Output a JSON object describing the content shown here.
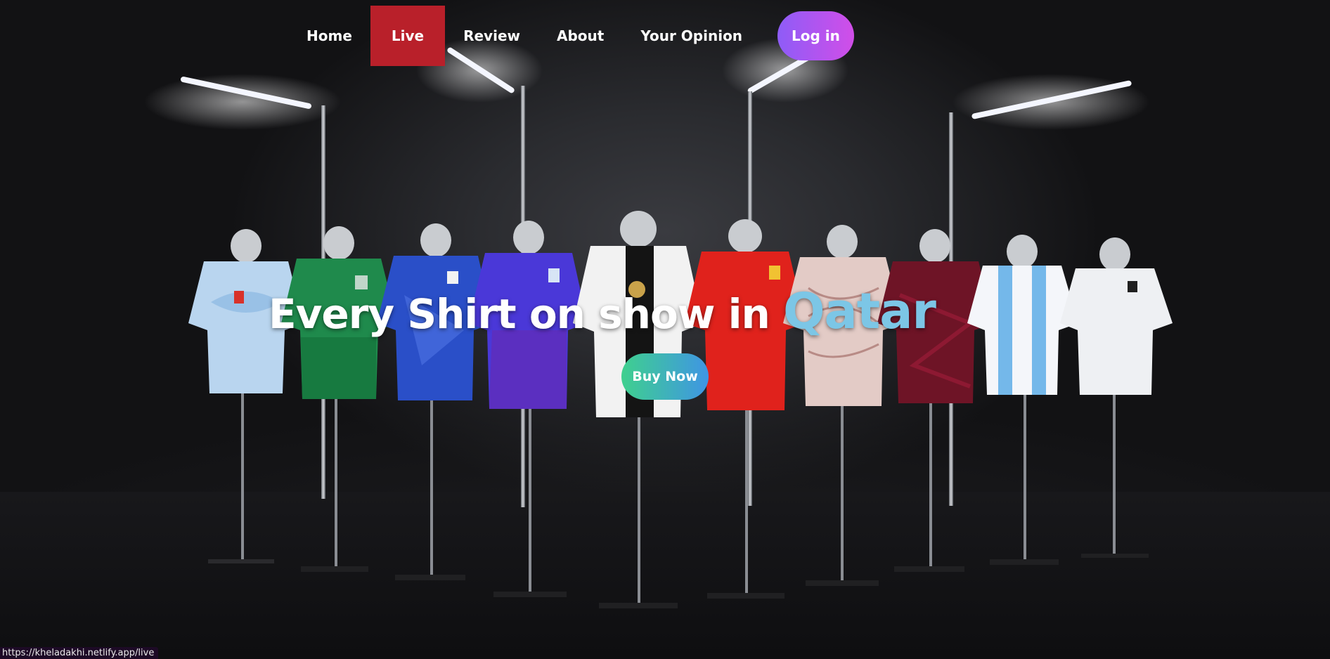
{
  "nav": {
    "items": [
      {
        "label": "Home",
        "active": false
      },
      {
        "label": "Live",
        "active": true
      },
      {
        "label": "Review",
        "active": false
      },
      {
        "label": "About",
        "active": false
      },
      {
        "label": "Your Opinion",
        "active": false
      }
    ],
    "login_label": "Log in"
  },
  "hero": {
    "title": "Every Shirt on show in",
    "title_accent": "Qatar",
    "cta_label": "Buy Now"
  },
  "status_bar": {
    "url": "https://kheladakhi.netlify.app/live"
  },
  "colors": {
    "active_nav": "#b9202a",
    "accent_text": "#7cc6e6",
    "login_gradient": [
      "#8e5cf7",
      "#d14ee8"
    ],
    "cta_gradient": [
      "#3fd08e",
      "#3f95e4"
    ]
  }
}
